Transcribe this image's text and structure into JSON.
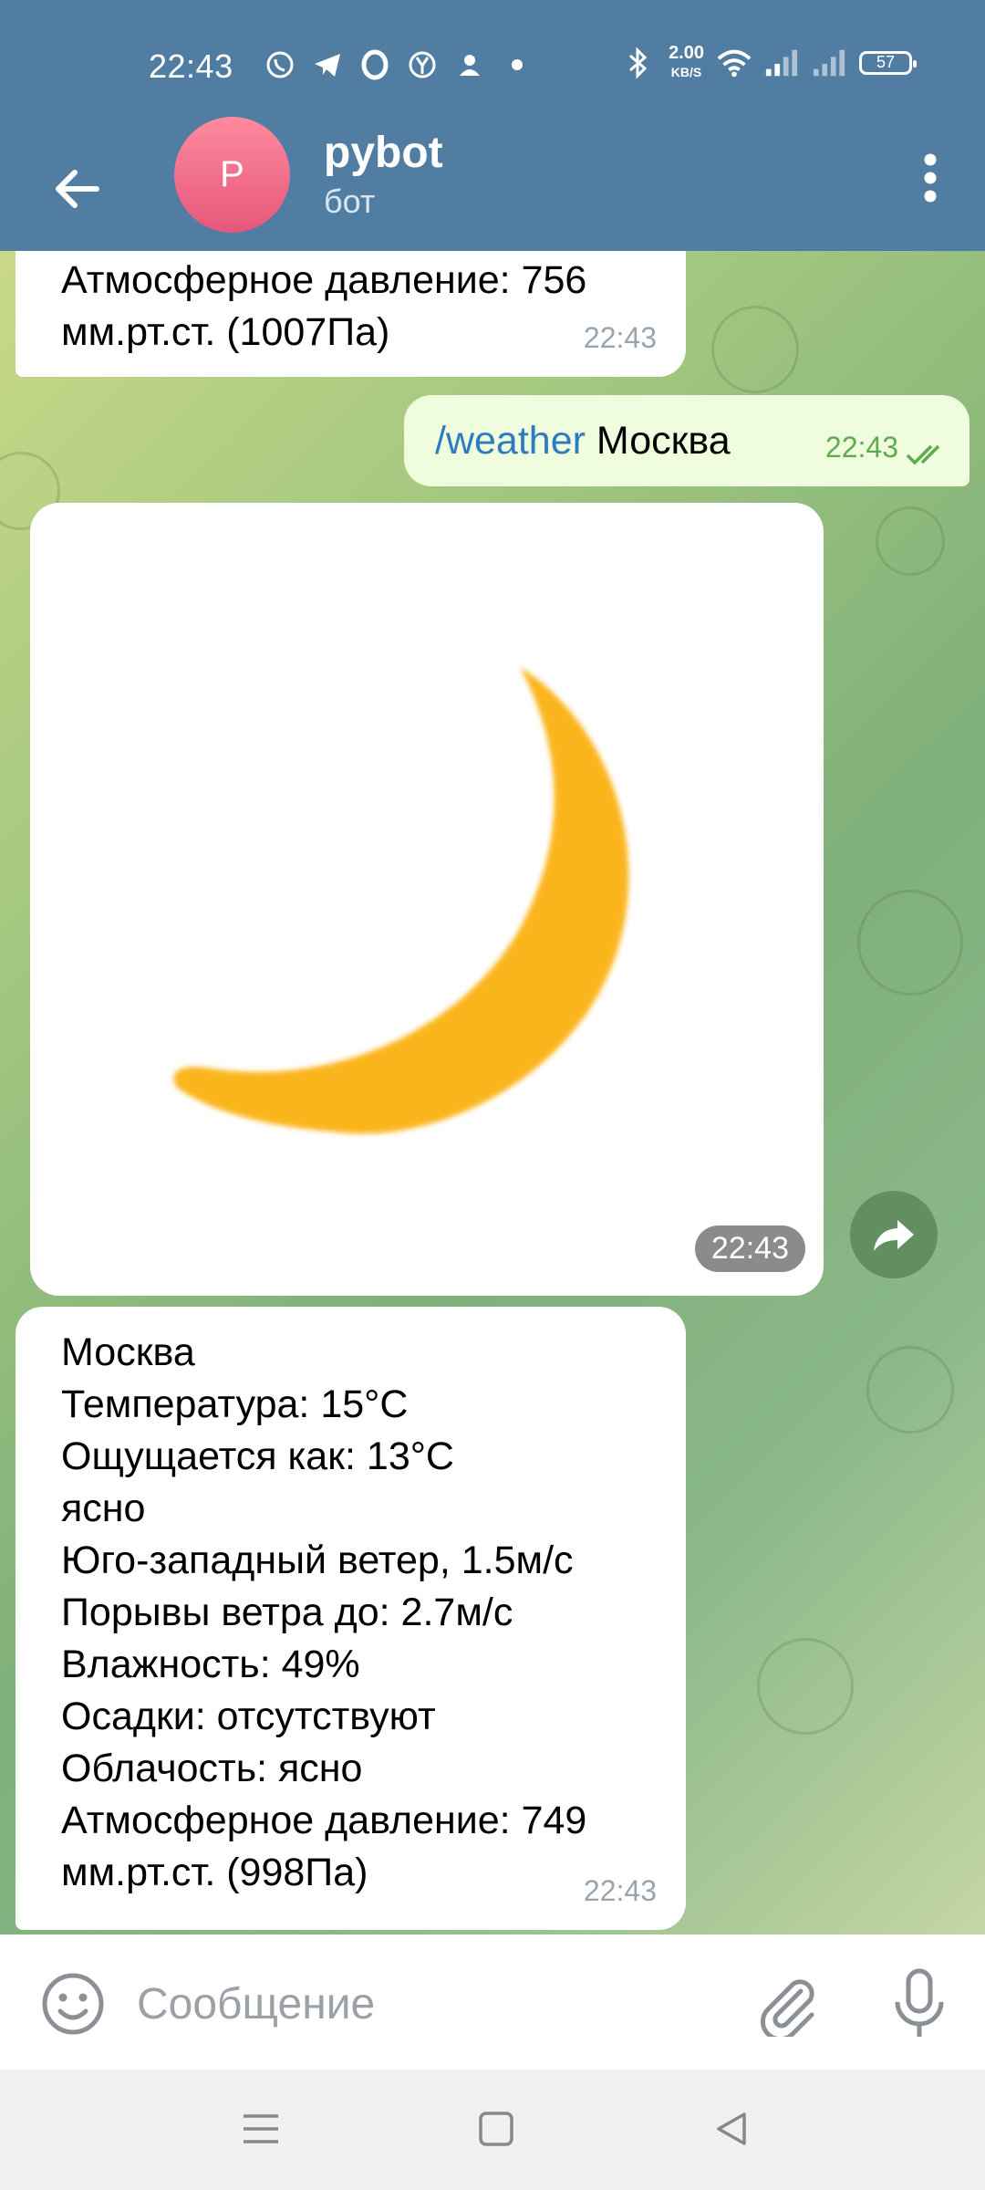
{
  "status_bar": {
    "time": "22:43",
    "network_speed_value": "2.00",
    "network_speed_unit": "KB/S",
    "battery": "57"
  },
  "header": {
    "avatar_letter": "P",
    "title": "pybot",
    "subtitle": "бот"
  },
  "messages": [
    {
      "id": "msg-prev",
      "from": "bot",
      "text": "Атмосферное давление: 756\nмм.рт.ст. (1007Па)",
      "time": "22:43"
    },
    {
      "id": "msg-user",
      "from": "user",
      "command": "/weather",
      "argument": "Москва",
      "time": "22:43",
      "status": "read"
    },
    {
      "id": "msg-photo",
      "from": "bot",
      "image": "crescent-moon",
      "time": "22:43"
    },
    {
      "id": "msg-weather",
      "from": "bot",
      "lines": [
        "Москва",
        "Температура: 15°C",
        "Ощущается как: 13°C",
        "ясно",
        "Юго-западный ветер, 1.5м/с",
        "Порывы ветра до: 2.7м/с",
        "Влажность: 49%",
        "Осадки: отсутствуют",
        "Облачость: ясно",
        "Атмосферное давление: 749",
        "мм.рт.ст. (998Па)"
      ],
      "time": "22:43"
    }
  ],
  "input": {
    "placeholder": "Сообщение"
  },
  "colors": {
    "header": "#517da2",
    "outgoing_bubble": "#effdde",
    "incoming_bubble": "#ffffff",
    "command_link": "#2e7bbd",
    "read_check": "#5eab4f",
    "moon": "#fbb51c"
  },
  "icons": {
    "back": "arrow-left-icon",
    "menu": "more-vertical-icon",
    "share": "forward-icon",
    "emoji": "smiley-icon",
    "attach": "paperclip-icon",
    "mic": "microphone-icon"
  }
}
